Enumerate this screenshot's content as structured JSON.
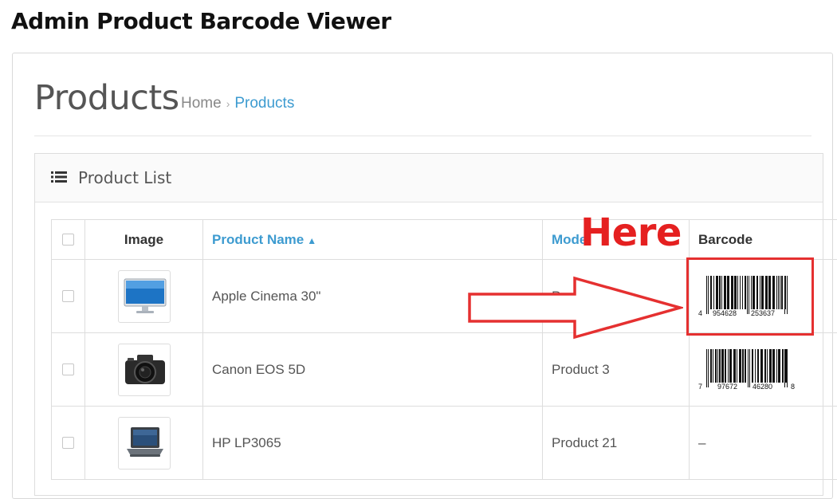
{
  "app_title": "Admin Product Barcode Viewer",
  "page": {
    "title": "Products",
    "breadcrumb": {
      "home": "Home",
      "separator": "›",
      "current": "Products"
    }
  },
  "list": {
    "title": "Product List",
    "icon": "list-icon",
    "columns": {
      "image": "Image",
      "name": "Product Name",
      "name_sort_indicator": "▲",
      "model": "Model",
      "barcode": "Barcode"
    },
    "rows": [
      {
        "image_icon": "monitor-icon",
        "name": "Apple Cinema 30\"",
        "model": "Product 15",
        "barcode": {
          "lead": "4",
          "left": "954628",
          "right": "253637",
          "trail": ""
        }
      },
      {
        "image_icon": "camera-icon",
        "name": "Canon EOS 5D",
        "model": "Product 3",
        "barcode": {
          "lead": "7",
          "left": "97672",
          "right": "46280",
          "trail": "8"
        }
      },
      {
        "image_icon": "laptop-icon",
        "name": "HP LP3065",
        "model": "Product 21",
        "barcode_text": "–"
      }
    ]
  },
  "annotation": {
    "label": "Here",
    "color": "#e53030"
  },
  "colors": {
    "link": "#3d9bd0",
    "text": "#555555",
    "border": "#dddddd"
  }
}
